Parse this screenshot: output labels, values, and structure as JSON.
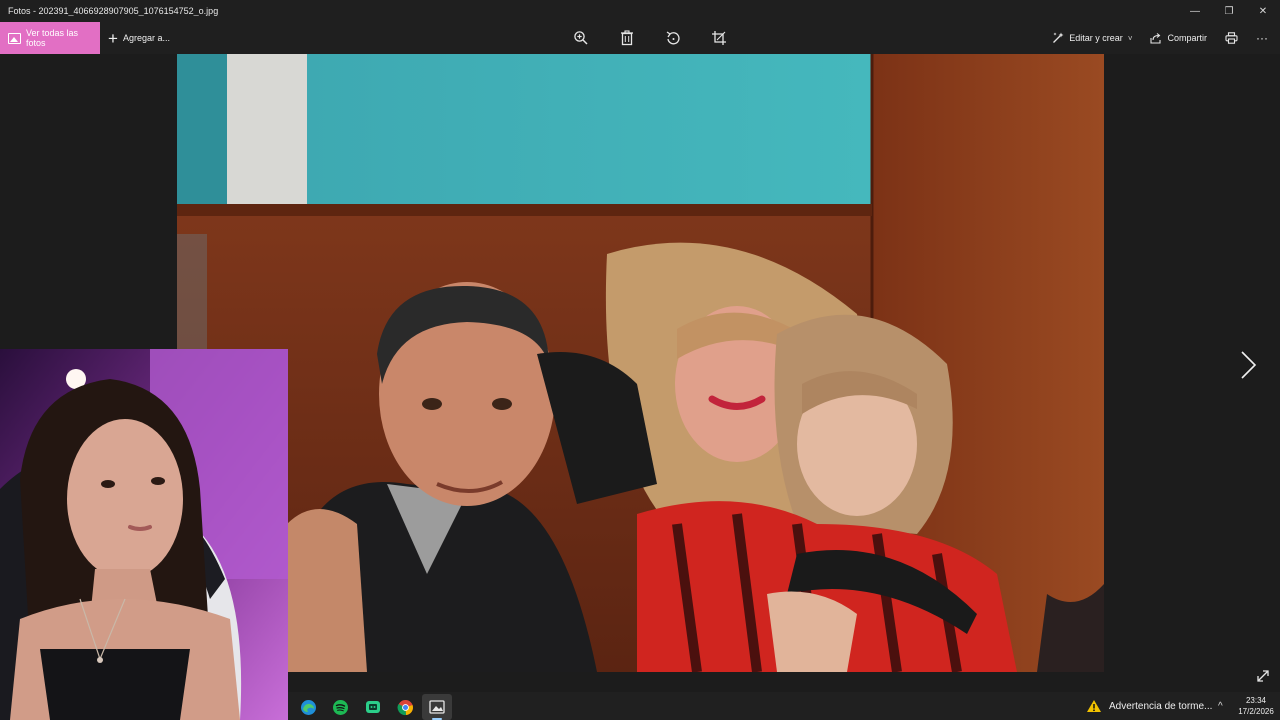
{
  "window": {
    "title": "Fotos - 202391_4066928907905_1076154752_o.jpg",
    "minimize_glyph": "—",
    "maximize_glyph": "❐",
    "close_glyph": "✕"
  },
  "toolbar": {
    "view_all_label": "Ver todas las fotos",
    "add_label": "Agregar a...",
    "edit_label": "Editar y crear",
    "share_label": "Compartir",
    "more_glyph": "···",
    "chevron_glyph": "˅"
  },
  "taskbar": {
    "weather_text": "Advertencia de torme...",
    "tray_chevron": "^",
    "time": "23:34",
    "date": "17/2/2026"
  },
  "colors": {
    "accent": "#e26fc4",
    "background": "#1c1c1c",
    "taskbar": "#202020"
  }
}
